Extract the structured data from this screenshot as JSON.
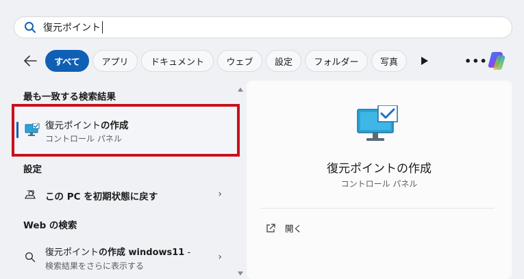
{
  "search": {
    "query": "復元ポイント"
  },
  "filters": {
    "tabs": [
      {
        "label": "すべて",
        "active": true
      },
      {
        "label": "アプリ"
      },
      {
        "label": "ドキュメント"
      },
      {
        "label": "ウェブ"
      },
      {
        "label": "設定"
      },
      {
        "label": "フォルダー"
      },
      {
        "label": "写真"
      }
    ],
    "more_label": "•••"
  },
  "results": {
    "best_match_heading": "最も一致する検索結果",
    "best_match": {
      "title_part1": "復元ポイント",
      "title_part2": "の作成",
      "subtitle": "コントロール パネル"
    },
    "settings_heading": "設定",
    "setting_item": {
      "label": "この PC を初期状態に戻す"
    },
    "web_heading": "Web の検索",
    "web_item": {
      "title_part1": "復元ポイント",
      "title_part2": "の作成 windows11",
      "title_suffix": " -",
      "subtitle": "検索結果をさらに表示する"
    }
  },
  "preview": {
    "title": "復元ポイントの作成",
    "subtitle": "コントロール パネル",
    "actions": [
      {
        "label": "開く",
        "icon": "open-external-icon"
      }
    ]
  },
  "colors": {
    "accent": "#0f5fb4",
    "highlight": "#c8111b"
  }
}
